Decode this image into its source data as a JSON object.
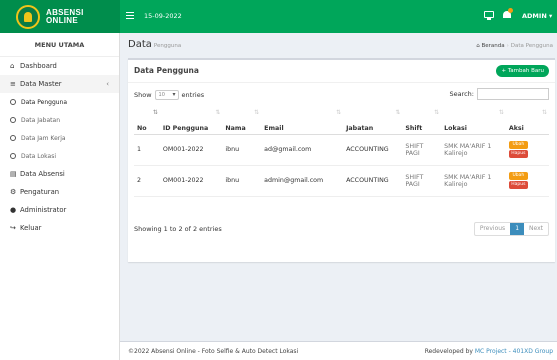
{
  "brand": {
    "line1": "ABSENSI",
    "line2": "ONLINE"
  },
  "topbar": {
    "date": "15-09-2022",
    "user": "ADMIN"
  },
  "sidebar": {
    "header": "MENU UTAMA",
    "items": [
      {
        "label": "Dashboard",
        "icon": "dashboard-icon"
      },
      {
        "label": "Data Master",
        "icon": "database-icon"
      },
      {
        "label": "Data Pengguna"
      },
      {
        "label": "Data Jabatan"
      },
      {
        "label": "Data Jam Kerja"
      },
      {
        "label": "Data Lokasi"
      },
      {
        "label": "Data Absensi",
        "icon": "table-icon"
      },
      {
        "label": "Pengaturan",
        "icon": "gears-icon"
      },
      {
        "label": "Administrator",
        "icon": "user-icon"
      },
      {
        "label": "Keluar",
        "icon": "signout-icon"
      }
    ]
  },
  "page": {
    "title": "Data",
    "subtitle": "Pengguna"
  },
  "breadcrumb": {
    "home": "Beranda",
    "current": "Data Pengguna"
  },
  "box": {
    "title": "Data Pengguna",
    "add_label": "+ Tambah Baru"
  },
  "table_controls": {
    "show": "Show",
    "entries_value": "10",
    "entries": "entries",
    "search_label": "Search:"
  },
  "table": {
    "headers": [
      "No",
      "ID Pengguna",
      "Nama",
      "Email",
      "Jabatan",
      "Shift",
      "Lokasi",
      "Aksi"
    ],
    "rows": [
      {
        "no": "1",
        "id": "OM001-2022",
        "nama": "ibnu",
        "email": "ad@gmail.com",
        "jabatan": "ACCOUNTING",
        "shift": "SHIFT PAGI",
        "lokasi": "SMK MA'ARIF 1 Kalirejo"
      },
      {
        "no": "2",
        "id": "OM001-2022",
        "nama": "ibnu",
        "email": "admin@gmail.com",
        "jabatan": "ACCOUNTING",
        "shift": "SHIFT PAGI",
        "lokasi": "SMK MA'ARIF 1 Kalirejo"
      }
    ],
    "edit_label": "Ubah",
    "delete_label": "Hapus"
  },
  "pagination": {
    "info": "Showing 1 to 2 of 2 entries",
    "previous": "Previous",
    "current": "1",
    "next": "Next"
  },
  "footer": {
    "left": "©2022 Absensi Online - Foto Selfie & Auto Detect Lokasi",
    "right_prefix": "Redeveloped by",
    "right_link": "MC Project - 401XD Group"
  },
  "colors": {
    "topbar": "#00a65a",
    "brand": "#008d4c",
    "primary": "#3c8dbc",
    "edit": "#f39c12",
    "delete": "#dd4b39"
  }
}
